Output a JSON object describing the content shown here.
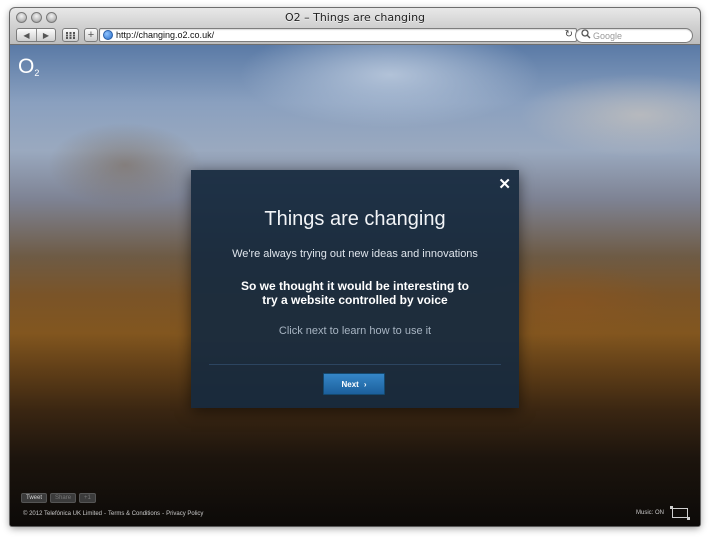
{
  "window": {
    "title": "O2 – Things are changing"
  },
  "toolbar": {
    "url": "http://changing.o2.co.uk/",
    "search_placeholder": "Google",
    "back_glyph": "◀",
    "forward_glyph": "▶",
    "add_glyph": "+",
    "reload_glyph": "↻",
    "search_glyph": "🔍"
  },
  "page": {
    "logo_main": "O",
    "logo_sub": "2",
    "modal": {
      "close_glyph": "✕",
      "title": "Things are changing",
      "line1": "We're always trying out new ideas and innovations",
      "bold_line1": "So we thought it would be interesting to",
      "bold_line2": "try a website controlled by voice",
      "hint": "Click next to learn how to use it",
      "next_label": "Next",
      "next_glyph": "›"
    },
    "social": {
      "tweet": "Tweet",
      "share": "Share",
      "plus": "+1"
    },
    "footer": {
      "copyright": "© 2012 Telefónica UK Limited",
      "sep1": "-",
      "terms": "Terms & Conditions",
      "sep2": "-",
      "privacy": "Privacy Policy",
      "music": "Music: ON"
    }
  },
  "colors": {
    "modal_bg": "#172a3e",
    "next_button": "#2a78bb",
    "footer_text": "#c9c9c9"
  }
}
